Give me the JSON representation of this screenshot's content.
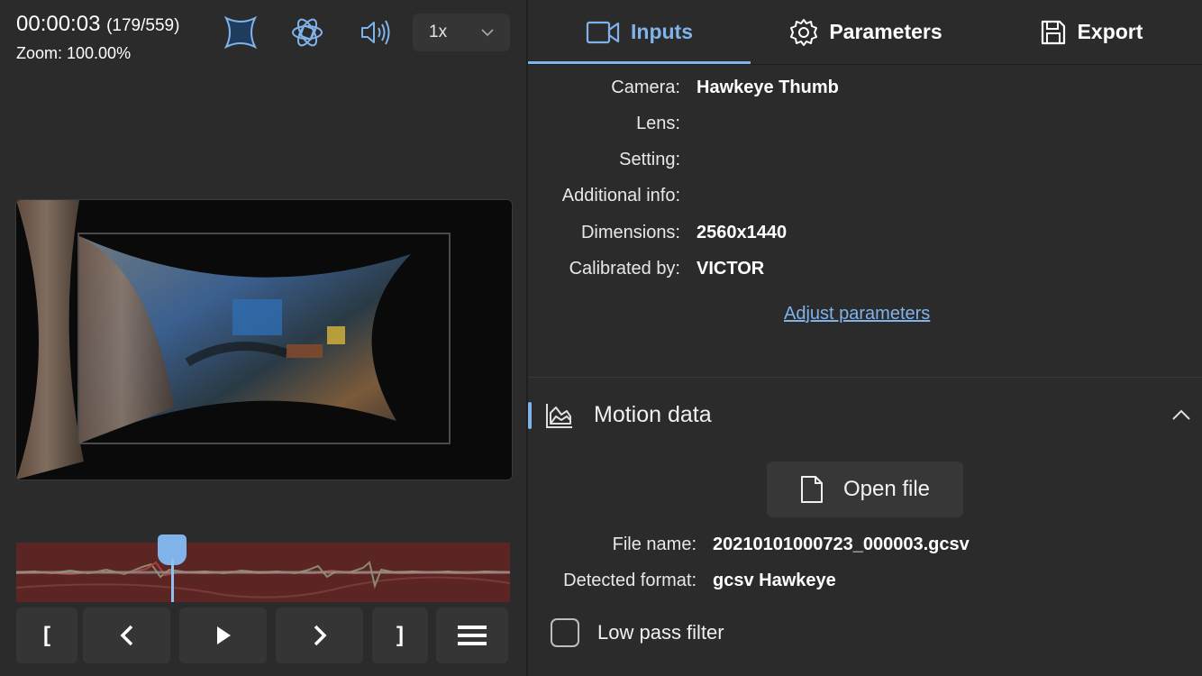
{
  "player": {
    "time": "00:00:03",
    "frames": "(179/559)",
    "zoom": "Zoom: 100.00%",
    "speed": "1x"
  },
  "toolbar_icons": [
    "lens-distortion-icon",
    "stabilization-icon",
    "speaker-volume-icon"
  ],
  "controls": {
    "in_point": "[",
    "out_point": "]"
  },
  "tabs": [
    {
      "label": "Inputs",
      "icon": "video-camera-icon",
      "active": true
    },
    {
      "label": "Parameters",
      "icon": "gear-icon",
      "active": false
    },
    {
      "label": "Export",
      "icon": "save-icon",
      "active": false
    }
  ],
  "lens_info": {
    "camera_label": "Camera:",
    "camera_value": "Hawkeye Thumb",
    "lens_label": "Lens:",
    "lens_value": "",
    "setting_label": "Setting:",
    "setting_value": "",
    "additional_label": "Additional info:",
    "additional_value": "",
    "dimensions_label": "Dimensions:",
    "dimensions_value": "2560x1440",
    "calibrated_label": "Calibrated by:",
    "calibrated_value": "VICTOR",
    "adjust_link": "Adjust parameters"
  },
  "motion": {
    "title": "Motion data",
    "open_file": "Open file",
    "file_name_label": "File name:",
    "file_name_value": "20210101000723_000003.gcsv",
    "format_label": "Detected format:",
    "format_value": "gcsv Hawkeye",
    "low_pass_label": "Low pass filter",
    "low_pass_checked": false
  },
  "colors": {
    "accent": "#7fb3ea",
    "timeline_bg": "#5a2523",
    "panel_bg": "#2b2b2b",
    "button_bg": "#353535"
  }
}
